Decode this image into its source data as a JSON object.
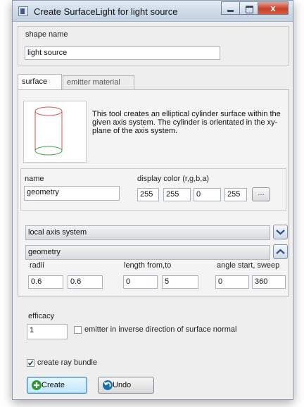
{
  "window": {
    "title": "Create SurfaceLight for light source",
    "close_glyph": "x"
  },
  "shape": {
    "label": "shape name",
    "value": "light source"
  },
  "tabs": [
    {
      "label": "surface"
    },
    {
      "label": "emitter material"
    }
  ],
  "surface": {
    "description": "This tool creates an elliptical cylinder surface within the given axis system. The cylinder is orientated in the xy-plane of the axis system.",
    "name_label": "name",
    "name_value": "geometry",
    "color_label": "display color (r,g,b,a)",
    "color_values": [
      "255",
      "255",
      "0",
      "255"
    ],
    "color_button_label": "...",
    "axis_section_label": "local axis system",
    "geometry_section_label": "geometry",
    "radii_label": "radii",
    "radii_values": [
      "0.6",
      "0.6"
    ],
    "length_label": "length from,to",
    "length_values": [
      "0",
      "5"
    ],
    "angle_label": "angle start, sweep",
    "angle_values": [
      "0",
      "360"
    ]
  },
  "efficacy": {
    "label": "efficacy",
    "value": "1"
  },
  "emitter_inverse": {
    "label": "emitter in inverse direction of surface normal",
    "checked": false
  },
  "ray_bundle": {
    "label": "create ray bundle",
    "checked": true
  },
  "buttons": {
    "create_label": "Create",
    "undo_label": "Undo"
  },
  "icons": {
    "app": "window-icon",
    "minimize": "minimize-icon",
    "maximize": "maximize-icon",
    "close": "close-icon",
    "cylinder": "cylinder-preview-icon",
    "expand": "chevron-down-icon",
    "collapse": "chevron-up-icon",
    "create": "plus-icon",
    "undo": "undo-icon",
    "checkmark": "checkmark-icon"
  },
  "colors": {
    "create_icon": "#2e9a34",
    "undo_icon": "#1b6fa8",
    "chevron": "#2a4f8a",
    "cylinder_side": "#d9534f",
    "cylinder_base": "#3aa84a"
  }
}
